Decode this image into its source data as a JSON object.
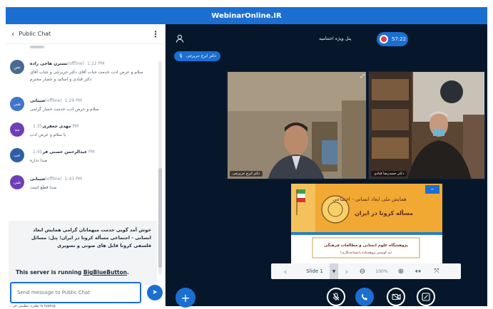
{
  "app": {
    "title": "WebinarOnline.IR"
  },
  "chat": {
    "title": "Public Chat",
    "messages": [
      {
        "initials": "نس",
        "name": "نسترن هاجی زاده",
        "tag": "(offline)",
        "time": "1:22 PM",
        "text": "سلام و عرض ادب خدمت جناب آقای دکتر حریرچی و جناب آقای دکتر قبادی و اساتید و حضار محترم",
        "color": "#4b6a91"
      },
      {
        "initials": "شی",
        "name": "شیبانی",
        "tag": "(offline)",
        "time": "1:29 PM",
        "text": "سلام و عرض ادب خدمت حضار گرامی",
        "color": "#3f76c8"
      },
      {
        "initials": "مه",
        "name": "مهدی جعفری",
        "tag": "",
        "time": "1:35 PM",
        "text": "با سلام و عرض ادب",
        "color": "#6f3fb8"
      },
      {
        "initials": "عب",
        "name": "عبدالرحمن حسنی فر",
        "tag": "",
        "time": "1:41 PM",
        "text": "صدا نداره",
        "color": "#2f5ea8"
      },
      {
        "initials": "شی",
        "name": "شیبانی",
        "tag": "(offline)",
        "time": "1:43 PM",
        "text": "صدا قطع است",
        "color": "#6f3fb8"
      }
    ],
    "welcome_text": "خوش آمد گویی خدمت میهمانان گرامی همایش ابعاد انسانی - اجتماعی مسأله کرونا در ایران؛ پنل: مسائل فلسفی کرونا قابل های صوتی و تصویری",
    "server_prefix": "This server is running ",
    "server_link": "BigBlueButton",
    "server_suffix": ".",
    "input_placeholder": "Send message to Public Chat",
    "typing_text": "... نظیره عظیمی فر is typing"
  },
  "main": {
    "room_title": "پنل ویژه اختتامیه",
    "timer": "57:22",
    "talker_name": "دکتر ایرج حریرچی",
    "videos": [
      {
        "label": "دکتر ایرج حریرچی"
      },
      {
        "label": "دکتر حمیدرضا قبادی"
      }
    ],
    "slide": {
      "banner_line1": "همایش ملی ابعاد انسانی - اجتماعی",
      "banner_line2": "مسأله کرونا در ایران",
      "institute": "پژوهشگاه علوم انسانی و مطالعات فرهنگی",
      "institute_sub": "(به کوشش پژوهشکده دانشنامه‌نگاری)",
      "name": "Slide 1",
      "zoom": "100%"
    }
  },
  "colors": {
    "accent": "#1b6fd1",
    "stage": "#06172b",
    "record": "#e23b4b"
  },
  "icons": [
    "chevron-left-icon",
    "kebab-menu-icon",
    "send-icon",
    "user-icon",
    "record-icon",
    "microphone-icon",
    "expand-icon",
    "minimize-icon",
    "zoom-out-icon",
    "zoom-in-icon",
    "fit-width-icon",
    "fullscreen-icon",
    "plus-icon",
    "mic-muted-icon",
    "phone-icon",
    "video-icon",
    "screenshare-icon"
  ]
}
